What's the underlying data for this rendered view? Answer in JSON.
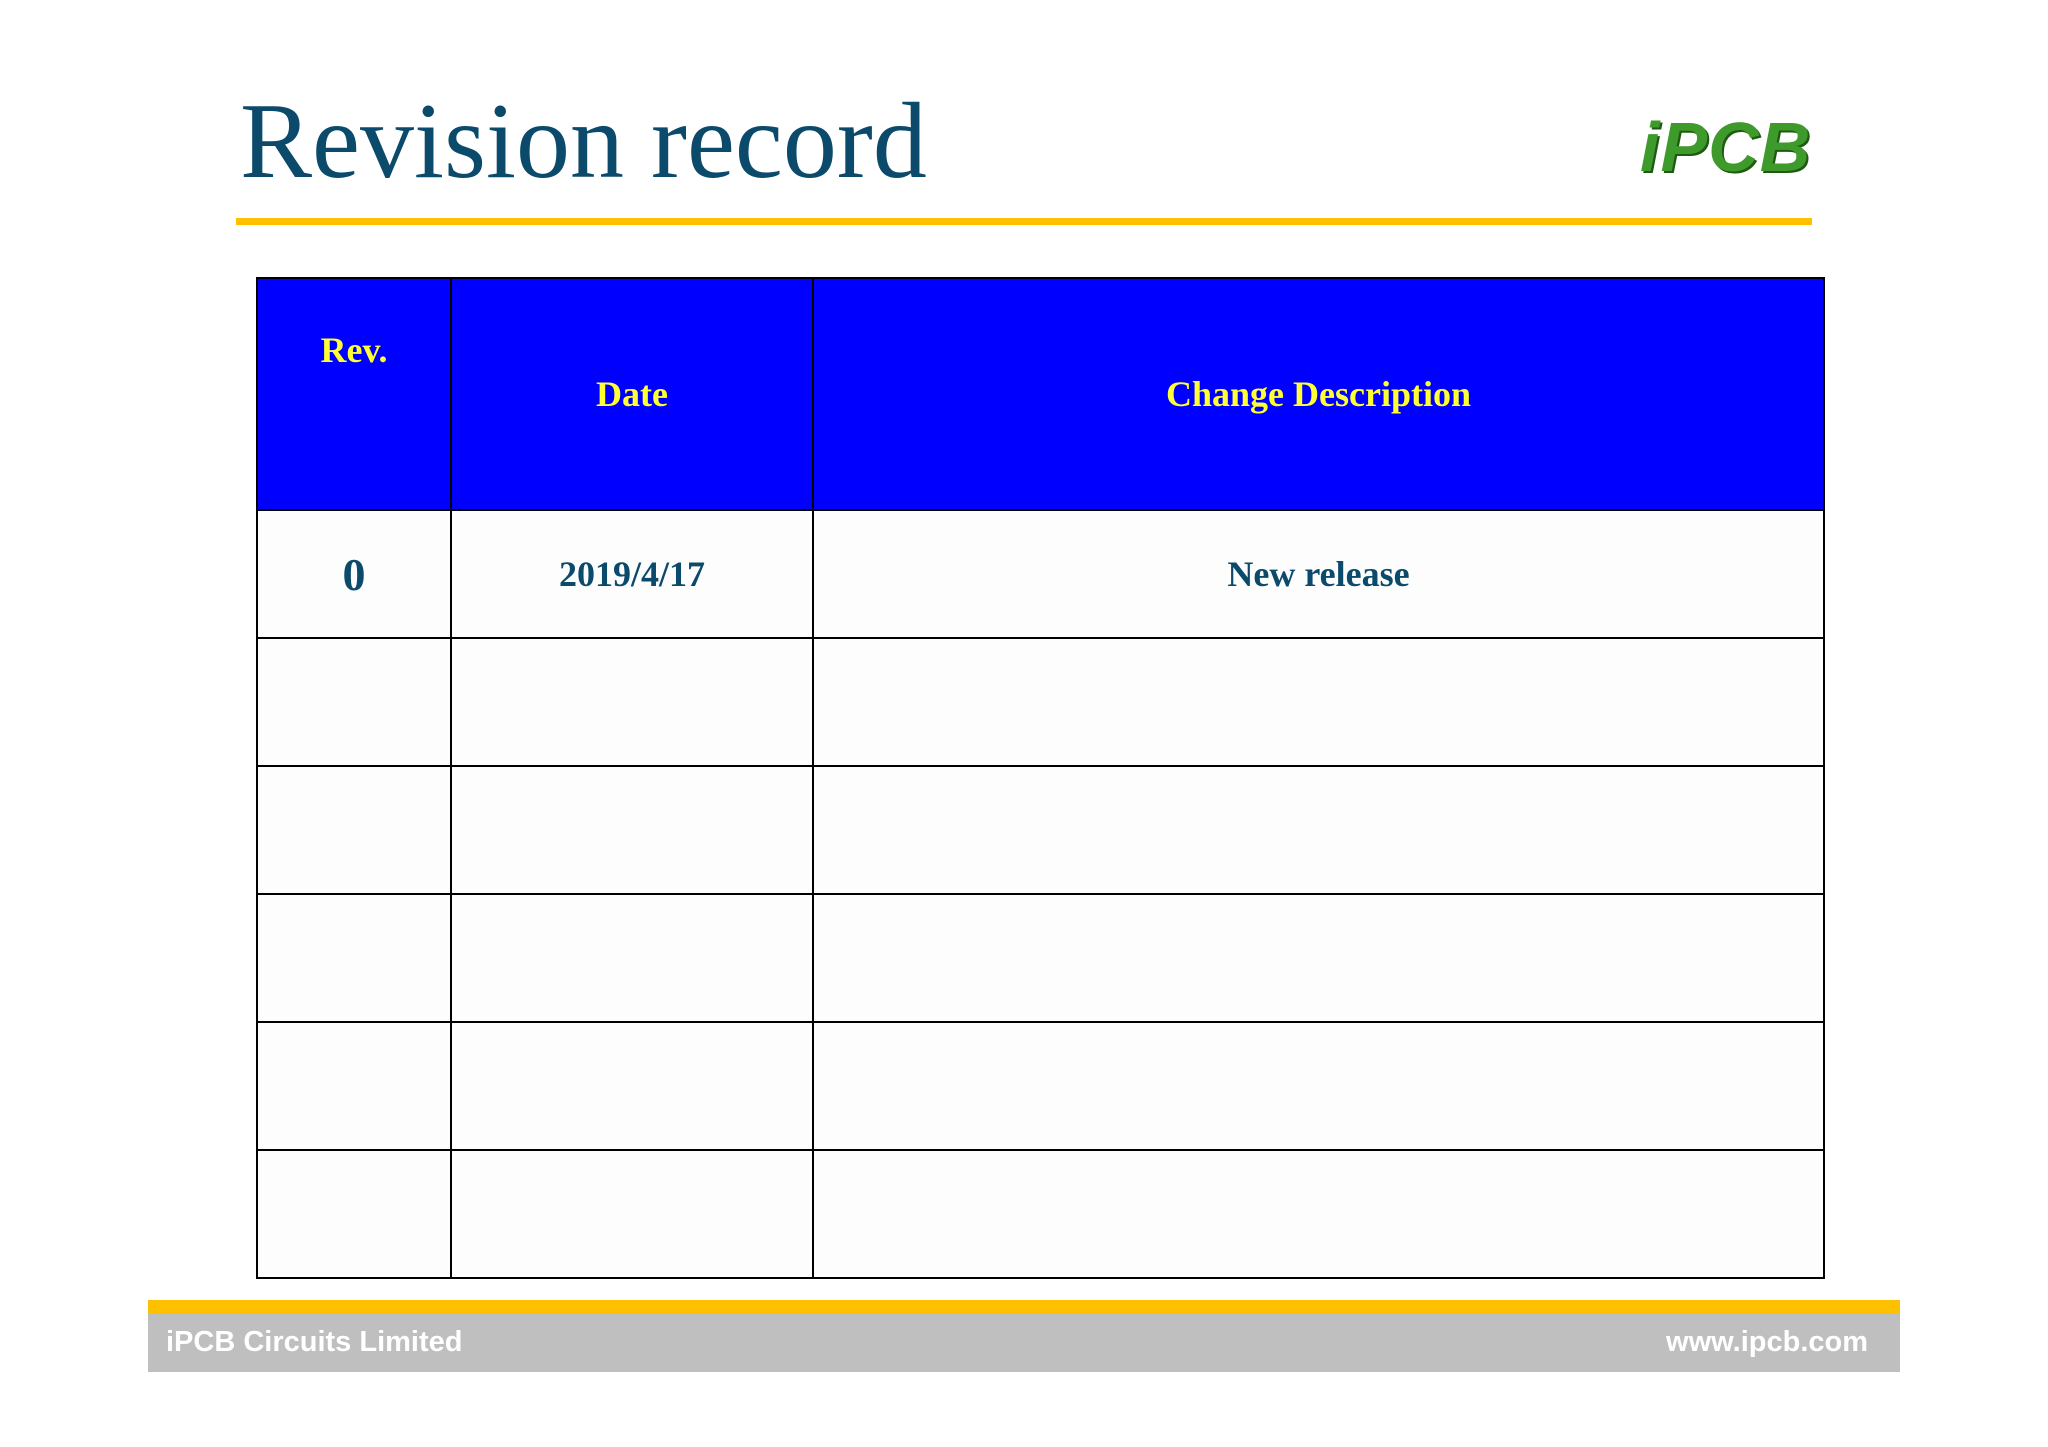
{
  "title": "Revision record",
  "logo": {
    "text": "iPCB",
    "color": "#3e9a2a"
  },
  "table": {
    "headers": {
      "rev": "Rev.",
      "date": "Date",
      "description": "Change Description"
    },
    "rows": [
      {
        "rev": "0",
        "date": "2019/4/17",
        "description": "New release"
      },
      {
        "rev": "",
        "date": "",
        "description": ""
      },
      {
        "rev": "",
        "date": "",
        "description": ""
      },
      {
        "rev": "",
        "date": "",
        "description": ""
      },
      {
        "rev": "",
        "date": "",
        "description": ""
      },
      {
        "rev": "",
        "date": "",
        "description": ""
      }
    ]
  },
  "watermark": "www.ipcb.com",
  "footer": {
    "company": "iPCB Circuits Limited",
    "website": "www.ipcb.com"
  },
  "colors": {
    "accent_rule": "#ffc000",
    "header_bg": "#0000ff",
    "header_text": "#ffff33",
    "title_text": "#0b4a6a",
    "footer_bar": "#bfbfbf"
  }
}
